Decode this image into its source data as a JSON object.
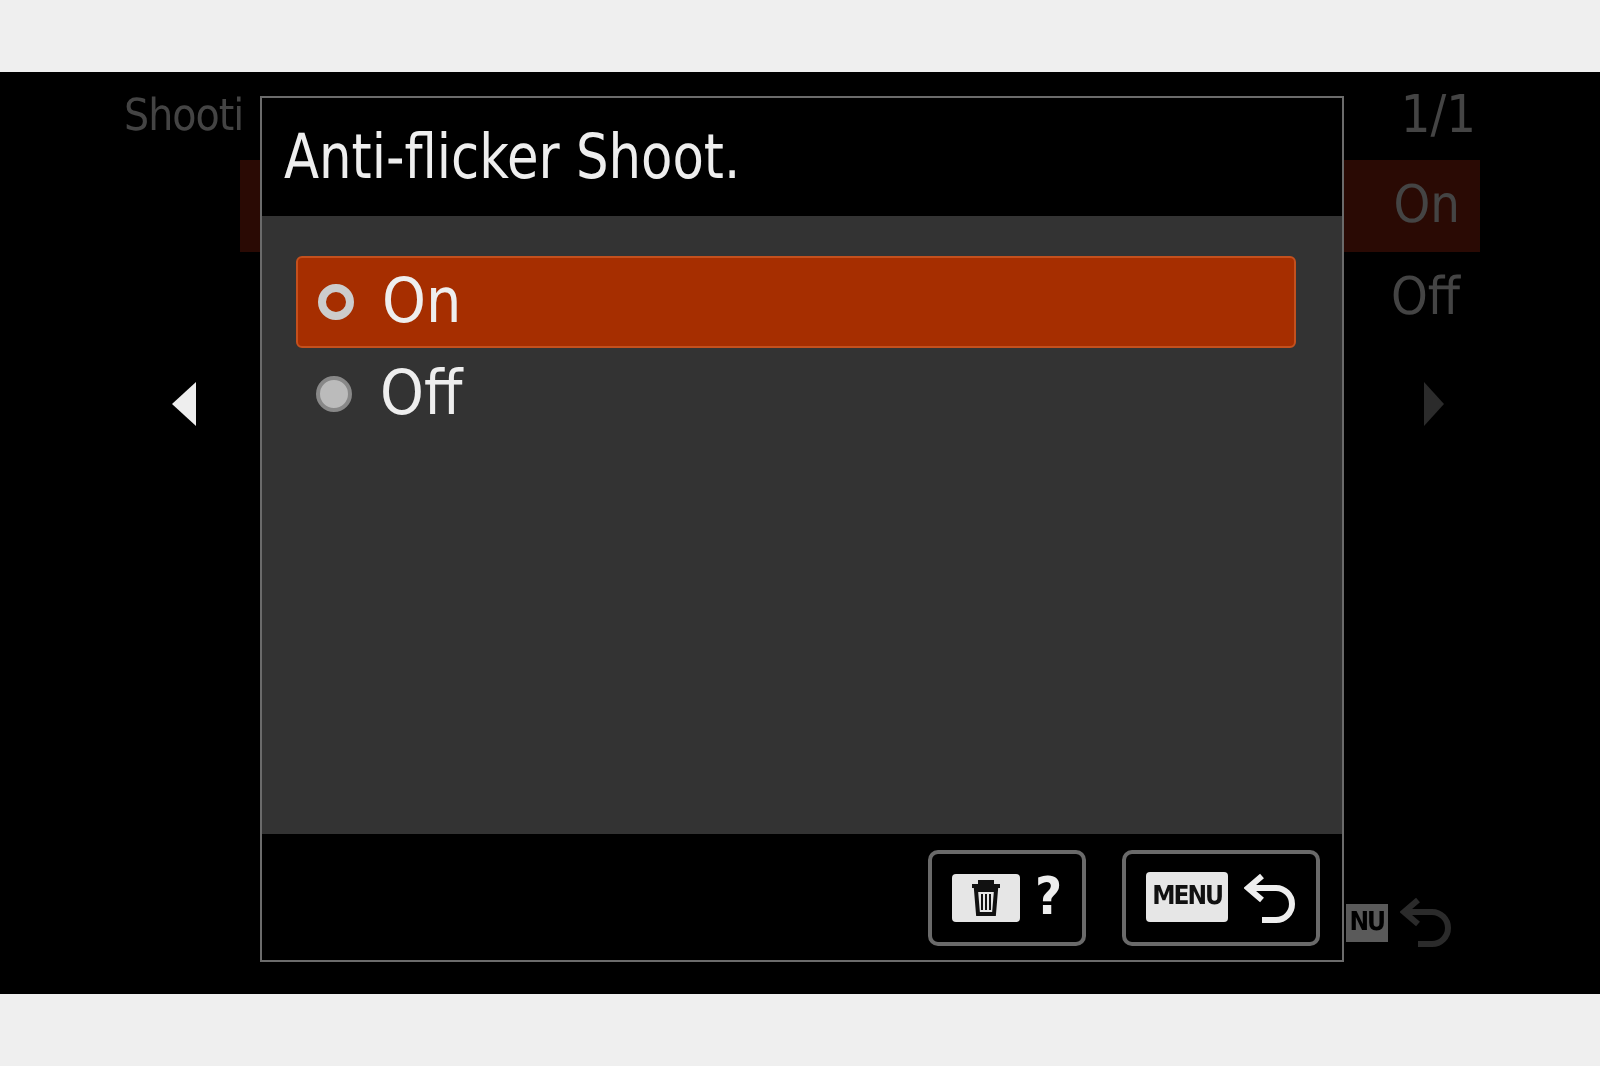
{
  "background_menu": {
    "title": "Shooti",
    "page": "1/1",
    "rows": [
      {
        "value": "On",
        "selected": true
      },
      {
        "value": "Off",
        "selected": false
      }
    ],
    "menu_key": "NU"
  },
  "dialog": {
    "title": "Anti-flicker Shoot.",
    "options": [
      {
        "label": "On",
        "selected": true
      },
      {
        "label": "Off",
        "selected": false
      }
    ],
    "buttons": [
      {
        "kind": "delete-help",
        "label": "?"
      },
      {
        "kind": "menu-back",
        "key": "MENU"
      }
    ]
  }
}
